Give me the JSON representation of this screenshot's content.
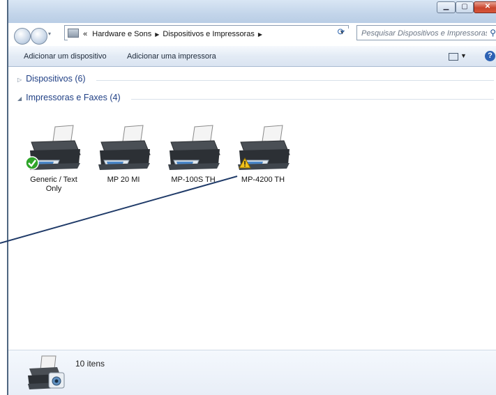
{
  "address": {
    "overflow": "«",
    "crumbs": [
      "Hardware e Sons",
      "Dispositivos e Impressoras"
    ]
  },
  "search": {
    "placeholder": "Pesquisar Dispositivos e Impressoras"
  },
  "toolbar": {
    "add_device": "Adicionar um dispositivo",
    "add_printer": "Adicionar uma impressora"
  },
  "groups": {
    "devices": {
      "label": "Dispositivos (6)",
      "expanded": false
    },
    "printers": {
      "label": "Impressoras e Faxes (4)",
      "expanded": true
    }
  },
  "printers": [
    {
      "name": "Generic / Text Only",
      "status": "default"
    },
    {
      "name": "MP 20 MI",
      "status": "none"
    },
    {
      "name": "MP-100S TH",
      "status": "none"
    },
    {
      "name": "MP-4200 TH",
      "status": "warning"
    }
  ],
  "details": {
    "count": "10 itens"
  },
  "colors": {
    "accent": "#1f3f84",
    "annotation_line": "#1f3a68",
    "default_badge": "#2fa52a",
    "warning_badge": "#f2c21b"
  }
}
